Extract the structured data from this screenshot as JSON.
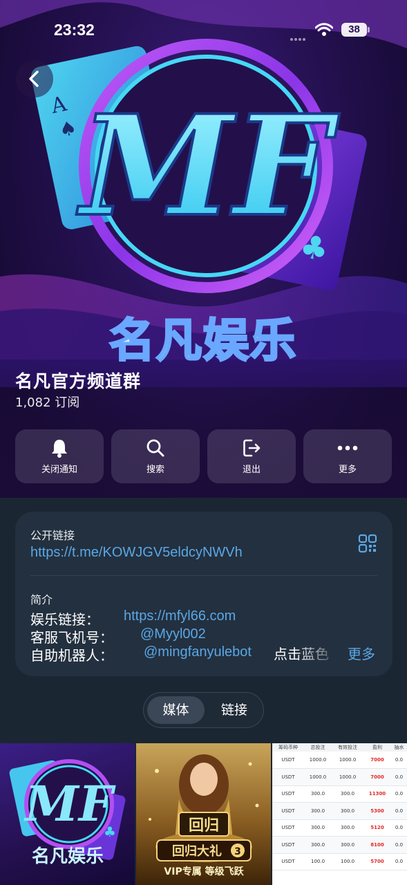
{
  "status_bar": {
    "time": "23:32",
    "battery": "38"
  },
  "hero": {
    "logo_text": "MF",
    "banner_text": "名凡娱乐",
    "colors": {
      "accent_cyan": "#46d8f5",
      "accent_purple": "#a64bf0",
      "background": "#24104f"
    }
  },
  "channel": {
    "title": "名凡官方频道群",
    "subscribers": "1,082 订阅"
  },
  "actions": [
    {
      "label": "关闭通知",
      "icon": "bell-icon"
    },
    {
      "label": "搜索",
      "icon": "search-icon"
    },
    {
      "label": "退出",
      "icon": "leave-icon"
    },
    {
      "label": "更多",
      "icon": "more-icon"
    }
  ],
  "info": {
    "link_label": "公开链接",
    "link": "https://t.me/KOWJGV5eldcyNWVh",
    "bio_label": "简介",
    "bio": [
      {
        "label": "娱乐链接：",
        "value": "https://mfyl66.com"
      },
      {
        "label": "客服飞机号：",
        "value": "@Myyl002"
      },
      {
        "label": "自助机器人：",
        "value": "@mingfanyulebot",
        "suffix": "点击蓝色"
      }
    ],
    "more": "更多"
  },
  "tabs": [
    {
      "label": "媒体",
      "active": true
    },
    {
      "label": "链接",
      "active": false
    }
  ],
  "media_grid": {
    "thumb1": {
      "logo": "MF",
      "caption": "名凡娱乐"
    },
    "thumb2": {
      "sign": "回归",
      "banner": "回归大礼",
      "banner_num": "3",
      "subtitle": "VIP专属 等级飞跃"
    },
    "thumb3": {
      "headers": [
        "筹码币种",
        "总投注",
        "有效投注",
        "盈利",
        "抽水"
      ],
      "rows": [
        [
          "USDT",
          "1000.0",
          "1000.0",
          "7000",
          "0.0"
        ],
        [
          "USDT",
          "1000.0",
          "1000.0",
          "7000",
          "0.0"
        ],
        [
          "USDT",
          "300.0",
          "300.0",
          "11300",
          "0.0"
        ],
        [
          "USDT",
          "300.0",
          "300.0",
          "5300",
          "0.0"
        ],
        [
          "USDT",
          "300.0",
          "300.0",
          "5120",
          "0.0"
        ],
        [
          "USDT",
          "300.0",
          "300.0",
          "8100",
          "0.0"
        ],
        [
          "USDT",
          "100.0",
          "100.0",
          "5700",
          "0.0"
        ]
      ]
    }
  }
}
